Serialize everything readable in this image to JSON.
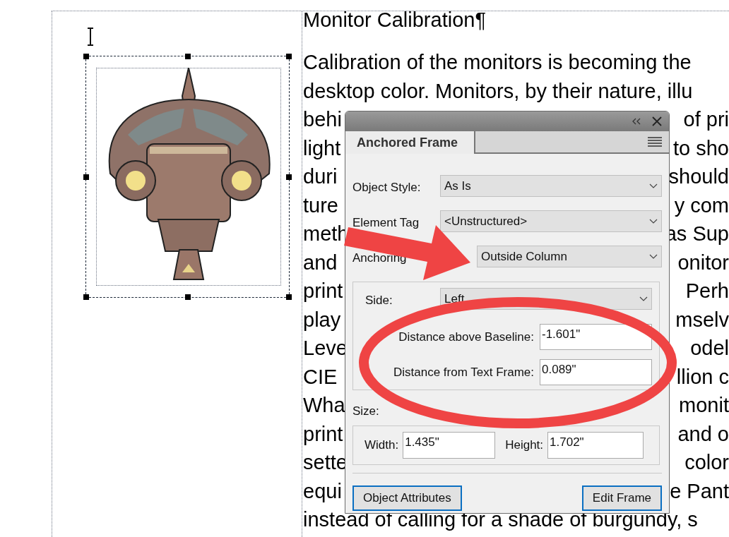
{
  "document": {
    "heading": "Monitor Calibration¶",
    "lines": [
      {
        "left": "Calibration of the monitors is becoming the"
      },
      {
        "left": "desktop color.  Monitors, by their nature, illu"
      },
      {
        "left": "behi",
        "right": "of pri"
      },
      {
        "left": "light",
        "right": "to sho"
      },
      {
        "left": "duri",
        "right": "should"
      },
      {
        "left": "ture",
        "right": "y com"
      },
      {
        "left": "meth",
        "right": "as Sup"
      },
      {
        "left": "and",
        "right": "onitor"
      },
      {
        "left": "print",
        "right": "Perh"
      },
      {
        "left": "play",
        "right": "mselv"
      },
      {
        "left": "Leve",
        "right": "odel"
      },
      {
        "left": "CIE",
        "right": "llion c"
      },
      {
        "left": "Wha",
        "right": "monit"
      },
      {
        "left": "print",
        "right": "and o"
      },
      {
        "left": "sette",
        "right": "color"
      },
      {
        "left": "equi",
        "right": "e Pant"
      },
      {
        "left": "instead of calling for a shade of burgundy, s"
      }
    ]
  },
  "panel": {
    "tab": "Anchored Frame",
    "fields": [
      {
        "label": "Object Style:",
        "value": "As Is"
      },
      {
        "label": "Element Tag",
        "value": "<Unstructured>"
      },
      {
        "label": "Anchoring",
        "value": "Outside Column"
      }
    ],
    "side": {
      "label": "Side:",
      "value": "Left"
    },
    "distances": [
      {
        "label": "Distance above Baseline:",
        "value": "-1.601\""
      },
      {
        "label": "Distance from Text Frame:",
        "value": "0.089\""
      }
    ],
    "size_label": "Size:",
    "size": [
      {
        "label": "Width:",
        "value": "1.435\""
      },
      {
        "label": "Height:",
        "value": "1.702\""
      }
    ],
    "buttons": [
      "Object Attributes",
      "Edit Frame"
    ]
  }
}
